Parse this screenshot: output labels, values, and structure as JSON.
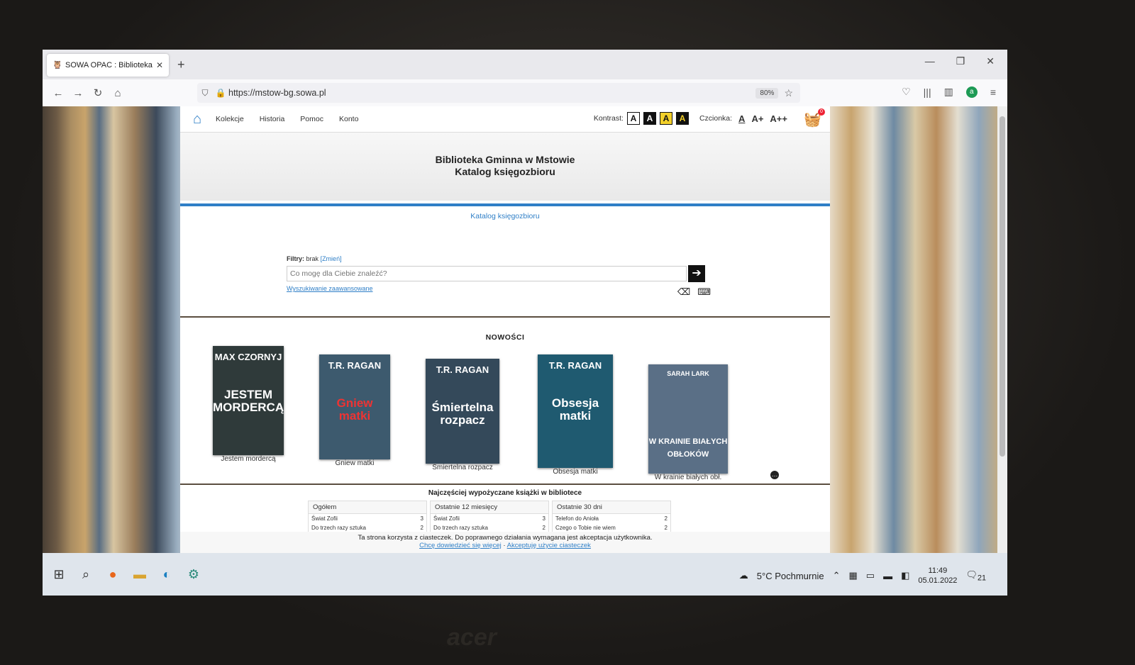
{
  "browser": {
    "tab_title": "SOWA OPAC : Biblioteka Gminn",
    "url": "https://mstow-bg.sowa.pl",
    "zoom": "80%"
  },
  "site": {
    "menu": [
      "Kolekcje",
      "Historia",
      "Pomoc",
      "Konto"
    ],
    "kontrast_label": "Kontrast:",
    "czcionka_label": "Czcionka:",
    "font_sizes": [
      "A",
      "A+",
      "A++"
    ],
    "cart_count": "0",
    "title_line1": "Biblioteka Gminna w Mstowie",
    "title_line2": "Katalog księgozbioru",
    "breadcrumb": "Katalog księgozbioru",
    "filters_label": "Filtry:",
    "filters_value": "brak",
    "filters_change": "[Zmień]",
    "search_placeholder": "Co mogę dla Ciebie znaleźć?",
    "advanced_search": "Wyszukiwanie zaawansowane",
    "news_heading": "NOWOŚCI",
    "popular_heading": "Najczęściej wypożyczane książki w bibliotece"
  },
  "books": [
    {
      "caption": "Jestem mordercą",
      "author": "MAX CZORNYJ",
      "title": "JESTEM MORDERCĄ",
      "color": "#2f3a3a"
    },
    {
      "caption": "Gniew matki",
      "author": "T.R. RAGAN",
      "title": "Gniew matki",
      "color": "#3d5a6e"
    },
    {
      "caption": "Śmiertelna rozpacz",
      "author": "T.R. RAGAN",
      "title": "Śmiertelna rozpacz",
      "color": "#34495a"
    },
    {
      "caption": "Obsesja matki",
      "author": "T.R. RAGAN",
      "title": "Obsesja matki",
      "color": "#1f5a70"
    },
    {
      "caption": "W krainie białych obł.",
      "author": "SARAH LARK",
      "title": "W KRAINIE BIAŁYCH OBŁOKÓW",
      "color": "#5a6f86"
    }
  ],
  "popular_tables": [
    {
      "header": "Ogółem",
      "rows": [
        {
          "t": "Świat Zofii",
          "n": "3"
        },
        {
          "t": "Do trzech razy sztuka",
          "n": "2"
        }
      ]
    },
    {
      "header": "Ostatnie 12 miesięcy",
      "rows": [
        {
          "t": "Świat Zofii",
          "n": "3"
        },
        {
          "t": "Do trzech razy sztuka",
          "n": "2"
        }
      ]
    },
    {
      "header": "Ostatnie 30 dni",
      "rows": [
        {
          "t": "Telefon do Anioła",
          "n": "2"
        },
        {
          "t": "Czego o Tobie nie wiem",
          "n": "2"
        }
      ]
    }
  ],
  "cookie": {
    "text": "Ta strona korzysta z ciasteczek. Do poprawnego działania wymagana jest akceptacja użytkownika.",
    "more": "Chcę dowiedzieć się więcej",
    "sep": " · ",
    "accept": "Akceptuję użycie ciasteczek"
  },
  "taskbar": {
    "weather": "5°C Pochmurnie",
    "time": "11:49",
    "date": "05.01.2022",
    "notifications": "21"
  },
  "laptop_brand": "acer",
  "colors": {
    "accent": "#2f7fc7",
    "yellow": "#f3d02a"
  }
}
